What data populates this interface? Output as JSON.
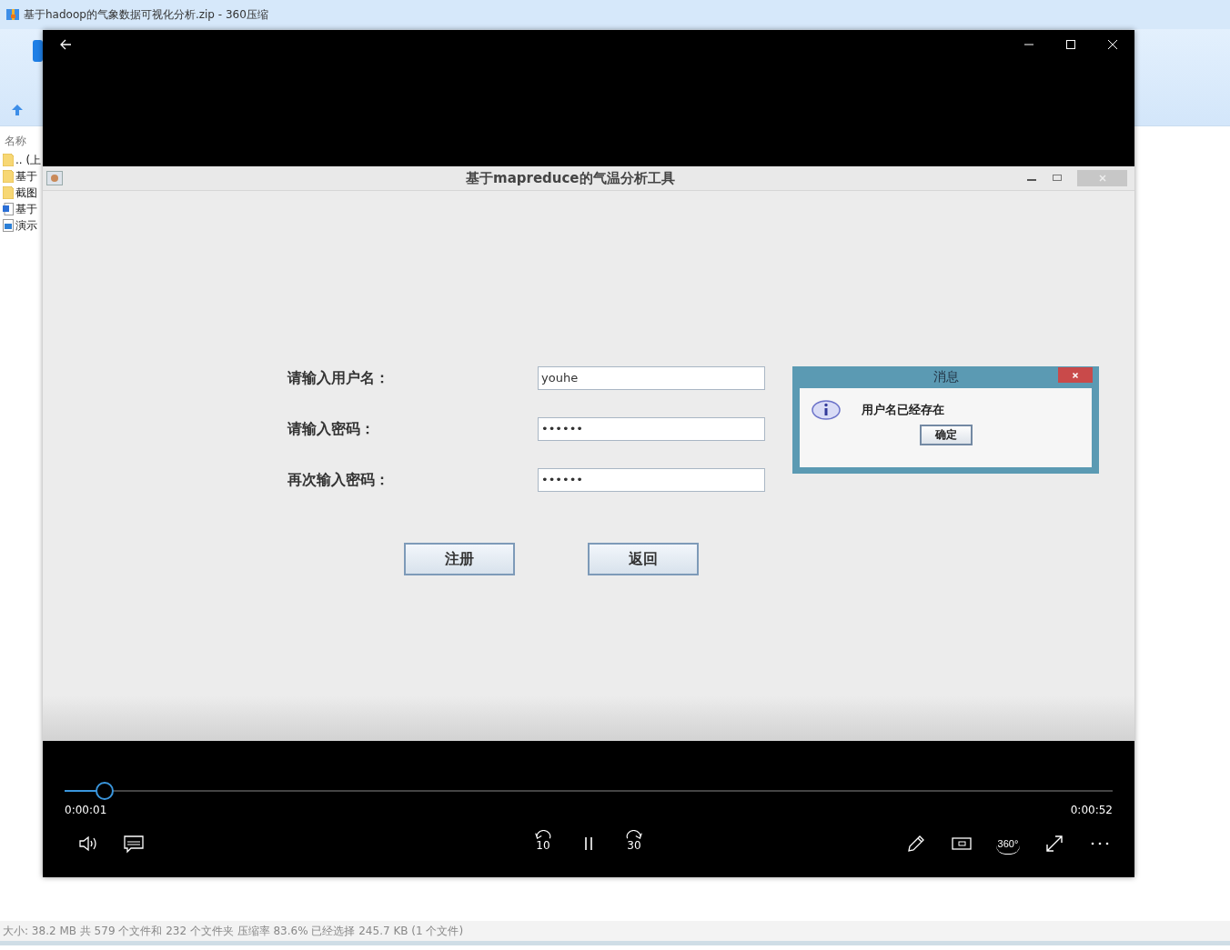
{
  "background_window": {
    "title": "基于hadoop的气象数据可视化分析.zip - 360压缩",
    "column_header": "名称",
    "files": [
      {
        "name": ".. (上",
        "kind": "folder"
      },
      {
        "name": "基于",
        "kind": "folder"
      },
      {
        "name": "截图",
        "kind": "folder"
      },
      {
        "name": "基于",
        "kind": "word"
      },
      {
        "name": "演示",
        "kind": "video"
      }
    ],
    "status_bar": "大小: 38.2 MB 共 579 个文件和 232 个文件夹 压缩率 83.6% 已经选择 245.7 KB (1 个文件)"
  },
  "player": {
    "video_app": {
      "title": "基于mapreduce的气温分析工具",
      "fields": [
        {
          "label": "请输入用户名：",
          "value": "youhe"
        },
        {
          "label": "请输入密码：",
          "value": "••••••"
        },
        {
          "label": "再次输入密码：",
          "value": "••••••"
        }
      ],
      "buttons": [
        "注册",
        "返回"
      ],
      "dialog": {
        "title": "消息",
        "message": "用户名已经存在",
        "button": "确定"
      }
    },
    "progress": {
      "level": 0.03
    },
    "elapsed": "0:00:01",
    "duration": "0:00:52",
    "skip_back": "10",
    "skip_forward": "30",
    "vr_label": "360°"
  }
}
